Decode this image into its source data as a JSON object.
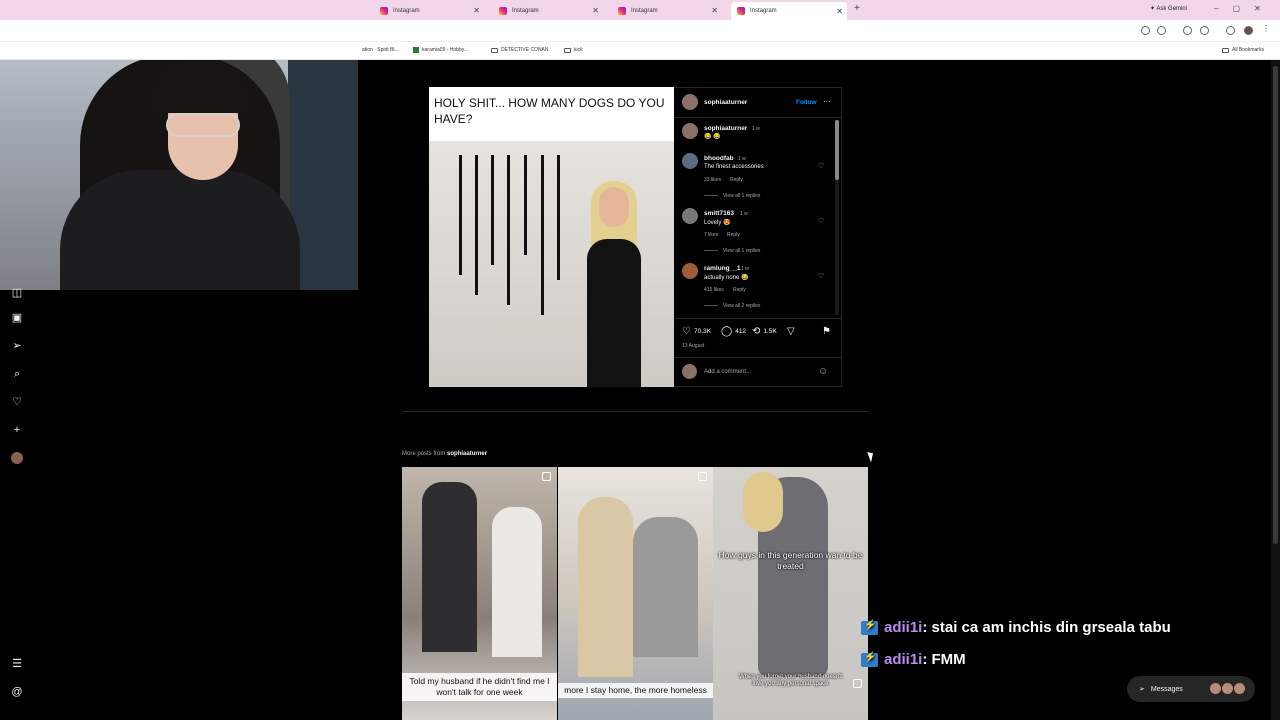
{
  "browser": {
    "tabs": [
      {
        "label": "Instagram",
        "active": false
      },
      {
        "label": "Instagram",
        "active": false
      },
      {
        "label": "Instagram",
        "active": false
      },
      {
        "label": "Instagram",
        "active": true
      }
    ],
    "ask_gemini": "Ask Gemini",
    "bookmarks": [
      "ation · Spirit Bl...",
      "karamia09 - Hobby...",
      "DETECTIVE CONAN",
      "kick"
    ],
    "all_bookmarks": "All Bookmarks"
  },
  "post": {
    "caption": "HOLY SHIT... HOW MANY DOGS DO YOU HAVE?",
    "author": "sophiaaturner",
    "follow": "Follow",
    "more": "···",
    "owner_comment": {
      "user": "sophiaaturner",
      "time": "1 w",
      "text": "😂 😂"
    },
    "comments": [
      {
        "user": "bhoodfab",
        "time": "1 w",
        "text": "The finest accessories",
        "likes": "33 likes",
        "reply": "Reply",
        "view": "View all 1 replies"
      },
      {
        "user": "smitt7163",
        "time": "1 w",
        "text": "Lovely 😍",
        "likes": "7 likes",
        "reply": "Reply",
        "view": "View all 1 replies"
      },
      {
        "user": "ramlung__1",
        "time": "1 w",
        "text": "actually none 😂",
        "likes": "415 likes",
        "reply": "Reply",
        "view": "View all 2 replies"
      }
    ],
    "likes_count": "70.3K",
    "comments_count": "412",
    "reposts_count": "1.5K",
    "date": "13 August",
    "add_comment": "Add a comment..."
  },
  "more_posts": {
    "label": "More posts from",
    "user": "sophiaaturner",
    "items": [
      {
        "overlay": "Told my husband if he didn't find me I won't talk for one week"
      },
      {
        "overlay": "more I stay home, the more homeless"
      },
      {
        "overlay": "How guys in this generation wan to be treated",
        "sub": "When you forget your husband doesn't love you any personal space"
      }
    ]
  },
  "chat": [
    {
      "nick": "adii1i",
      "message": ": stai ca am inchis din grseala tabu"
    },
    {
      "nick": "adii1i",
      "message": ": FMM"
    }
  ],
  "messages_button": "Messages",
  "colors": {
    "accent": "#0095f6",
    "tab_bar": "#f3d6ea",
    "chat_nick": "#b78df0"
  }
}
